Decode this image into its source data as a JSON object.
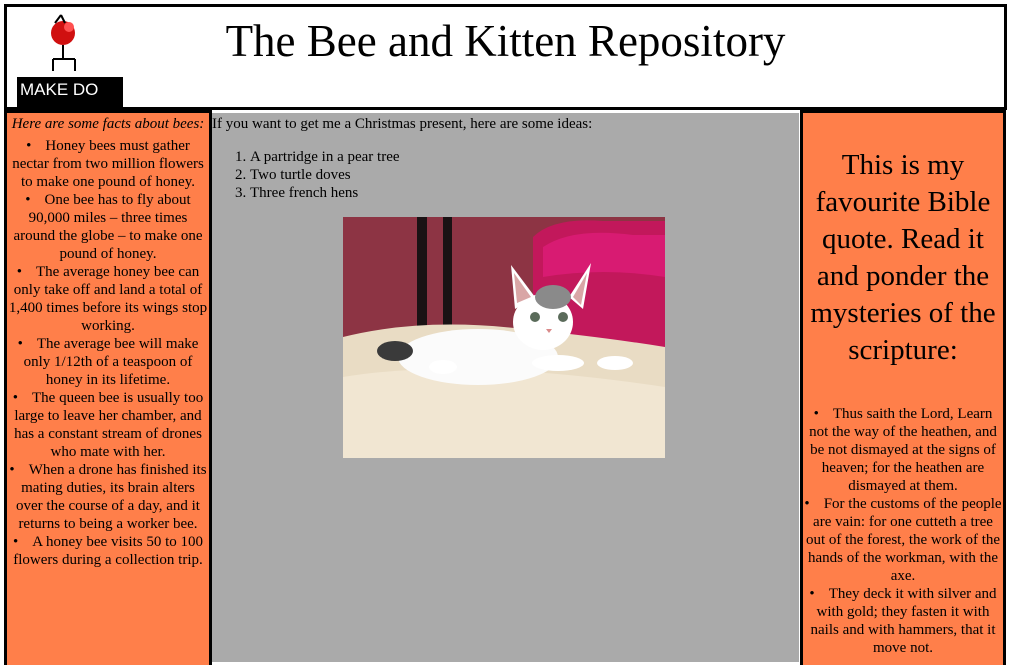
{
  "header": {
    "logo_label": "MAKE DO",
    "title": "The Bee and Kitten Repository"
  },
  "left": {
    "heading": "Here are some facts about bees:",
    "facts": [
      "Honey bees must gather nectar from two million flowers to make one pound of honey.",
      "One bee has to fly about 90,000 miles – three times around the globe – to make one pound of honey.",
      "The average honey bee can only take off and land a total of 1,400 times before its wings stop working.",
      "The average bee will make only 1/12th of a teaspoon of honey in its lifetime.",
      "The queen bee is usually too large to leave her chamber, and has a constant stream of drones who mate with her.",
      "When a drone has finished its mating duties, its brain alters over the course of a day, and it returns to being a worker bee.",
      "A honey bee visits 50 to 100 flowers during a collection trip."
    ]
  },
  "middle": {
    "intro": "If you want to get me a Christmas present, here are some ideas:",
    "ideas": [
      "A partridge in a pear tree",
      "Two turtle doves",
      "Three french hens"
    ]
  },
  "right": {
    "heading": "This is my favourite Bible quote. Read it and ponder the mysteries of the scripture:",
    "verses": [
      "Thus saith the Lord, Learn not the way of the heathen, and be not dismayed at the signs of heaven; for the heathen are dismayed at them.",
      "For the customs of the people are vain: for one cutteth a tree out of the forest, the work of the hands of the workman, with the axe.",
      "They deck it with silver and with gold; they fasten it with nails and with hammers, that it move not."
    ]
  },
  "colors": {
    "side_panel": "#ff7f4a",
    "middle_panel": "#aaaaaa",
    "border": "#000000"
  }
}
